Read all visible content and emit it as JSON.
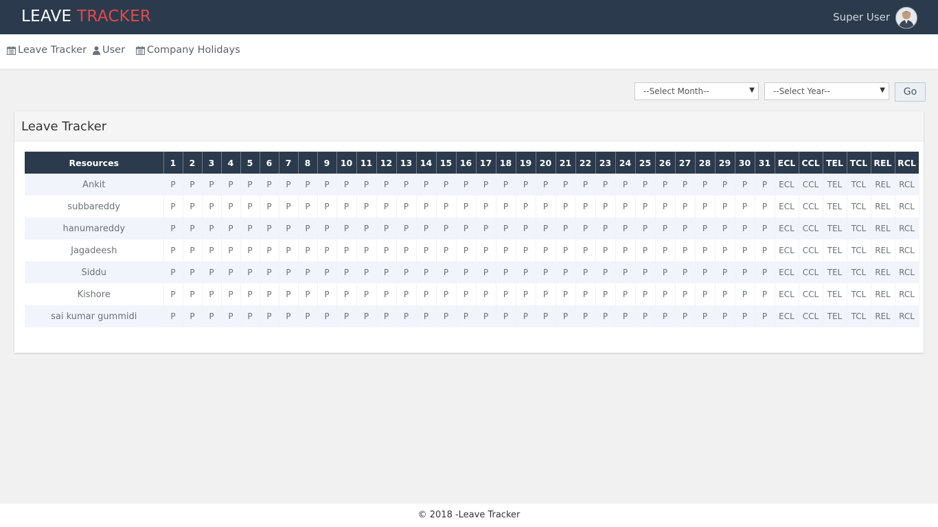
{
  "header": {
    "brand_part1": "LEAVE",
    "brand_part2": "TRACKER",
    "user_name": "Super User"
  },
  "nav": [
    {
      "label": "Leave Tracker",
      "icon": "calendar-icon"
    },
    {
      "label": "User",
      "icon": "user-icon"
    },
    {
      "label": "Company Holidays",
      "icon": "calendar-icon"
    }
  ],
  "filters": {
    "month_selected": "--Select Month--",
    "year_selected": "--Select Year--",
    "go_label": "Go"
  },
  "panel": {
    "title": "Leave Tracker"
  },
  "table": {
    "columns": [
      "Resources",
      "1",
      "2",
      "3",
      "4",
      "5",
      "6",
      "7",
      "8",
      "9",
      "10",
      "11",
      "12",
      "13",
      "14",
      "15",
      "16",
      "17",
      "18",
      "19",
      "20",
      "21",
      "22",
      "23",
      "24",
      "25",
      "26",
      "27",
      "28",
      "29",
      "30",
      "31",
      "ECL",
      "CCL",
      "TEL",
      "TCL",
      "REL",
      "RCL"
    ],
    "rows": [
      {
        "name": "Ankit"
      },
      {
        "name": "subbareddy"
      },
      {
        "name": "hanumareddy"
      },
      {
        "name": "Jagadeesh"
      },
      {
        "name": "Siddu"
      },
      {
        "name": "Kishore"
      },
      {
        "name": "sai kumar gummidi"
      }
    ],
    "day_value": "P",
    "summary_values": [
      "ECL",
      "CCL",
      "TEL",
      "TCL",
      "REL",
      "RCL"
    ]
  },
  "footer": {
    "text": "© 2018 -Leave Tracker"
  },
  "colors": {
    "topbar": "#2b3a4d",
    "brand_accent": "#e2494c",
    "row_stripe": "#f2f4fc"
  }
}
